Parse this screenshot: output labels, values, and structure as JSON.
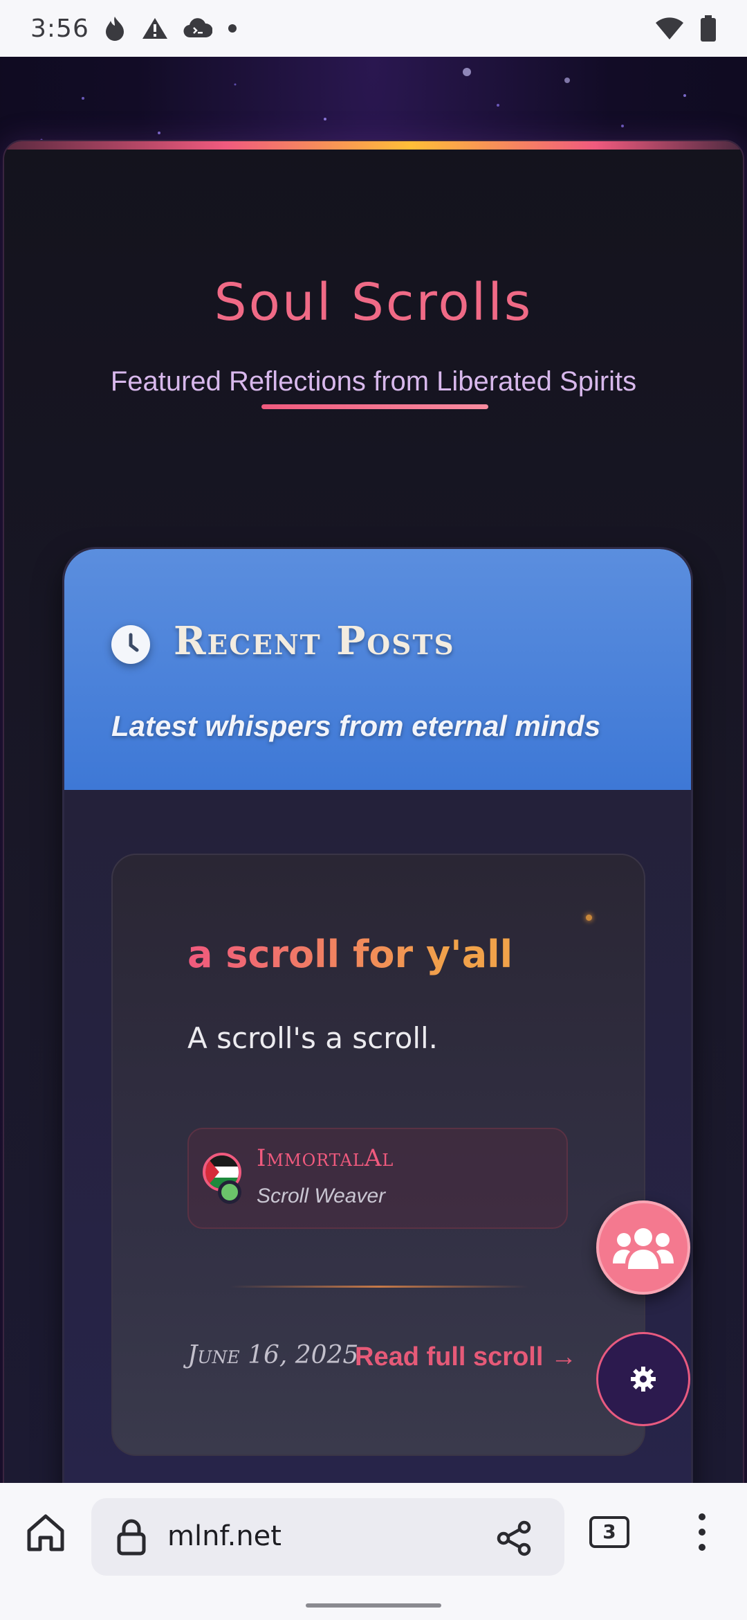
{
  "status_bar": {
    "time": "3:56",
    "left_icons": [
      "fire-icon",
      "warning-icon",
      "cloud-terminal-icon",
      "dot-icon"
    ],
    "right_icons": [
      "wifi-icon",
      "battery-icon"
    ]
  },
  "site": {
    "title": "Soul Scrolls",
    "subtitle": "Featured Reflections from Liberated Spirits"
  },
  "posts_panel": {
    "header_icon": "clock-icon",
    "title": "Recent Posts",
    "subtitle": "Latest whispers from eternal minds",
    "posts": [
      {
        "title": "a scroll for y'all",
        "excerpt": "A scroll's a scroll.",
        "author": {
          "name": "ImmortalAl",
          "role": "Scroll Weaver",
          "avatar": "palestine-flag-avatar",
          "online": true
        },
        "date": "June 16, 2025",
        "read_link": "Read full scroll →"
      }
    ]
  },
  "fabs": {
    "community_icon": "users-group-icon",
    "settings_icon": "gear-icon"
  },
  "browser": {
    "url": "mlnf.net",
    "tab_count": "3",
    "icons": [
      "home-icon",
      "lock-icon",
      "share-icon",
      "tabs-icon",
      "more-vertical-icon"
    ]
  },
  "colors": {
    "accent_pink": "#f05a7e",
    "accent_gold": "#f1a24a",
    "header_blue": "#4a80d9",
    "background": "#120c26"
  }
}
